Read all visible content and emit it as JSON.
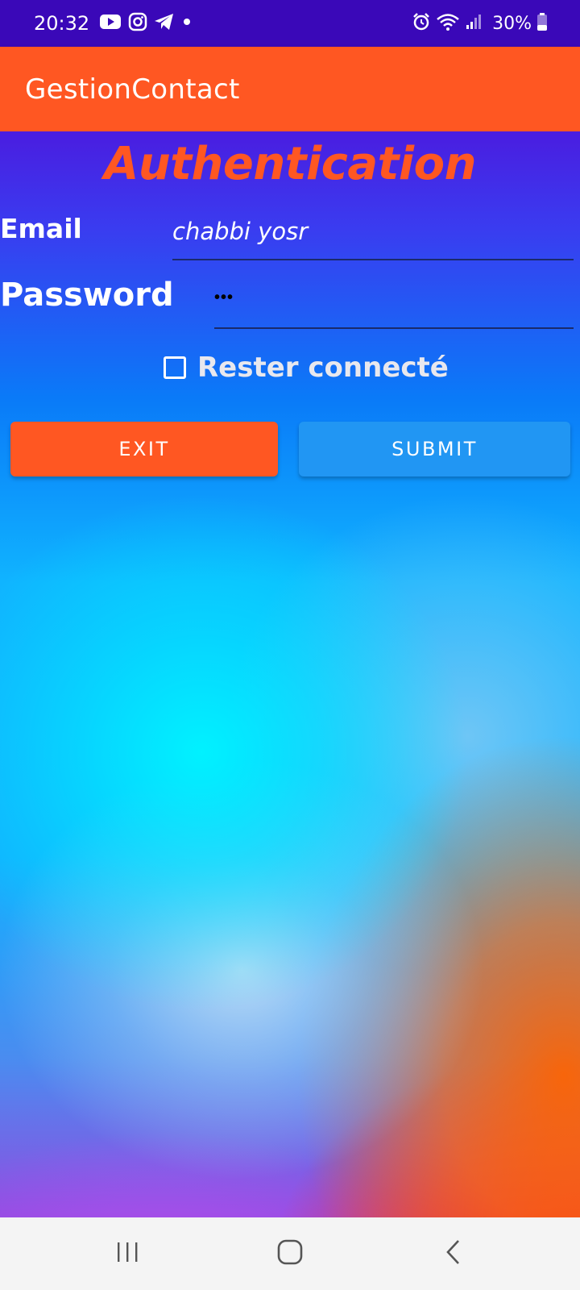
{
  "status_bar": {
    "time": "20:32",
    "battery": "30%",
    "icons_left": [
      "youtube-icon",
      "instagram-icon",
      "telegram-icon",
      "notification-dot-icon"
    ],
    "icons_right": [
      "alarm-icon",
      "wifi-icon",
      "signal-icon",
      "battery-icon"
    ],
    "battery_level": 0.3
  },
  "app_bar": {
    "title": "GestionContact",
    "color": "#ff5722"
  },
  "form": {
    "title": "Authentication",
    "email_label": "Email",
    "email_value": "chabbi yosr",
    "password_label": "Password",
    "password_value": "•••",
    "remember_label": "Rester connecté",
    "remember_checked": false
  },
  "buttons": {
    "exit": "EXIT",
    "submit": "SUBMIT",
    "exit_color": "#ff5722",
    "submit_color": "#2196f3"
  },
  "nav_bar": {
    "buttons": [
      "recent-apps-icon",
      "home-icon",
      "back-icon"
    ]
  }
}
